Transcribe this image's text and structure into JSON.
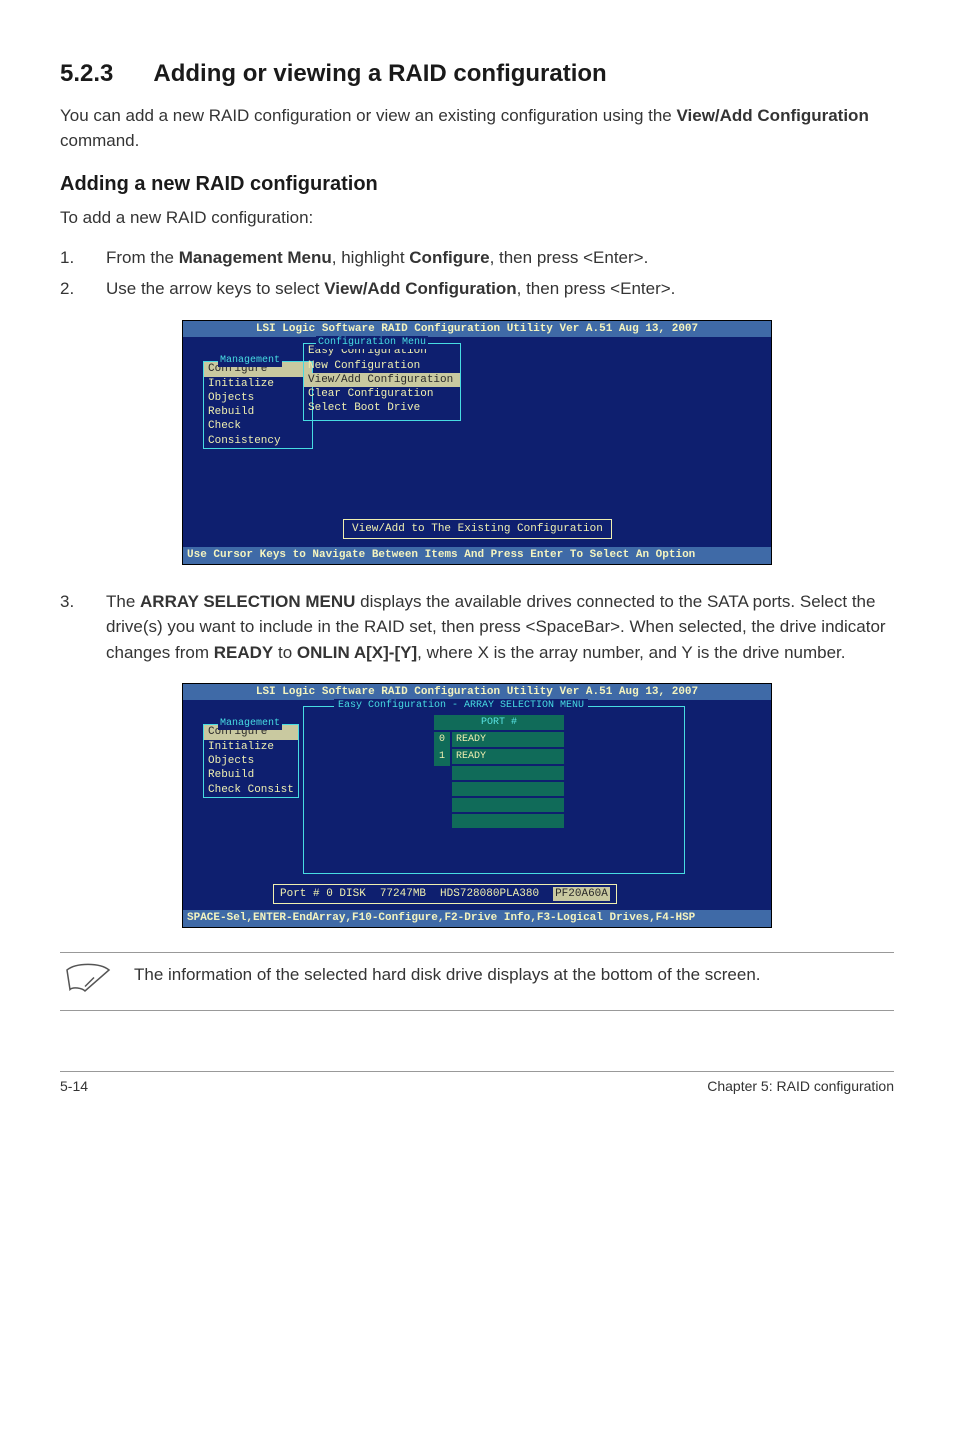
{
  "heading": {
    "number": "5.2.3",
    "title": "Adding or viewing a RAID configuration"
  },
  "intro_parts": [
    "You can add a new RAID configuration or view an existing configuration using the ",
    "View/Add Configuration",
    " command."
  ],
  "subheading": "Adding a new RAID configuration",
  "lead": "To add a new RAID configuration:",
  "step1": {
    "num": "1.",
    "p": [
      "From the ",
      "Management Menu",
      ", highlight ",
      "Configure",
      ", then press <Enter>."
    ]
  },
  "step2": {
    "num": "2.",
    "p": [
      "Use the arrow keys to select ",
      "View/Add Configuration",
      ", then press <Enter>."
    ]
  },
  "console1": {
    "header": "LSI Logic Software RAID Configuration Utility Ver A.51 Aug 13, 2007",
    "mgmt_label": "Management",
    "mgmt_items": [
      "Configure",
      "Initialize",
      "Objects",
      "Rebuild",
      "Check Consistency"
    ],
    "cfg_label": "Configuration Menu",
    "cfg_items": [
      "Easy Configuration",
      "New Configuration",
      "View/Add Configuration",
      "Clear Configuration",
      "Select Boot Drive"
    ],
    "popup": "View/Add to The Existing Configuration",
    "footer": "Use Cursor Keys to Navigate Between Items And Press Enter To Select An Option"
  },
  "step3": {
    "num": "3.",
    "p": [
      "The ",
      "ARRAY SELECTION MENU",
      " displays the available drives connected to the SATA ports. Select the drive(s) you want to include in the RAID set, then press <SpaceBar>. When selected, the drive indicator changes from ",
      "READY",
      " to ",
      "ONLIN A[X]-[Y]",
      ", where X is the array number, and Y is the drive number."
    ]
  },
  "console2": {
    "header": "LSI Logic Software RAID Configuration Utility Ver A.51 Aug 13, 2007",
    "mgmt_label": "Management",
    "mgmt_items": [
      "Configure",
      "Initialize",
      "Objects",
      "Rebuild",
      "Check Consist"
    ],
    "panel_label": "Easy Configuration - ARRAY SELECTION MENU",
    "port_header": "PORT #",
    "rows": [
      {
        "idx": "0",
        "status": "READY"
      },
      {
        "idx": "1",
        "status": "READY"
      }
    ],
    "status": {
      "port": "Port # 0 DISK",
      "size": "77247MB",
      "model": "HDS728080PLA380",
      "fw": "PF20A60A"
    },
    "footer": "SPACE-Sel,ENTER-EndArray,F10-Configure,F2-Drive Info,F3-Logical Drives,F4-HSP"
  },
  "note": "The information of the selected hard disk drive displays at the bottom of the screen.",
  "footer": {
    "left": "5-14",
    "right": "Chapter 5: RAID configuration"
  }
}
